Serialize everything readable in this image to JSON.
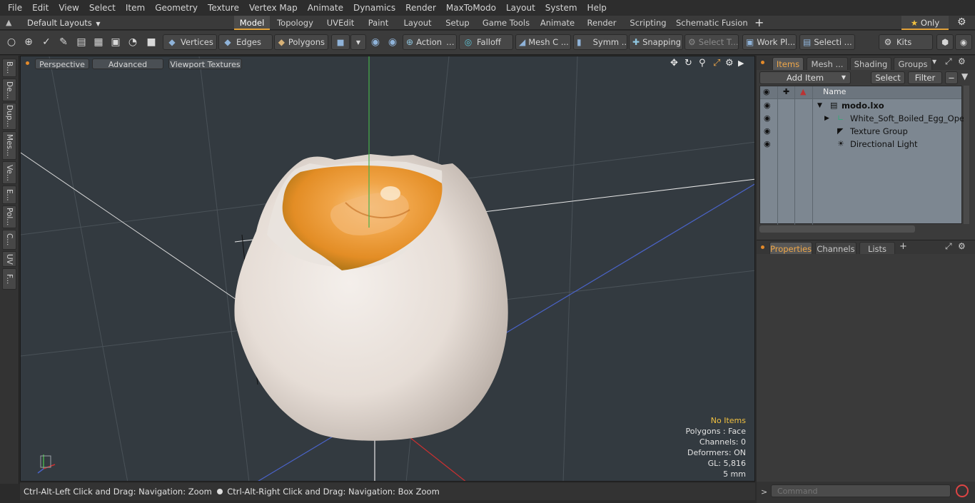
{
  "menu": [
    "File",
    "Edit",
    "View",
    "Select",
    "Item",
    "Geometry",
    "Texture",
    "Vertex Map",
    "Animate",
    "Dynamics",
    "Render",
    "MaxToModo",
    "Layout",
    "System",
    "Help"
  ],
  "layout_bar": {
    "layouts_label": "Default Layouts",
    "tabs": [
      "Model",
      "Topology",
      "UVEdit",
      "Paint",
      "Layout",
      "Setup",
      "Game Tools",
      "Animate",
      "Render",
      "Scripting",
      "Schematic Fusion"
    ],
    "active_tab": "Model",
    "only_label": "Only"
  },
  "toolbar": {
    "vertices": "Vertices",
    "edges": "Edges",
    "polygons": "Polygons",
    "action": "Action",
    "falloff": "Falloff",
    "mesh_c": "Mesh C ...",
    "symm": "Symm ...",
    "snapping": "Snapping",
    "select_t": "Select T...",
    "work_pl": "Work Pl...",
    "selecti": "Selecti ...",
    "kits": "Kits"
  },
  "left_tabs": [
    "B...",
    "De...",
    "Dup...",
    "Mes...",
    "Ve...",
    "E...",
    "Pol...",
    "C...",
    "UV",
    "F..."
  ],
  "viewport": {
    "tabs": [
      "Perspective",
      "Advanced",
      "Viewport Textures"
    ],
    "stats": {
      "no_items": "No Items",
      "polygons": "Polygons : Face",
      "channels": "Channels: 0",
      "deformers": "Deformers: ON",
      "gl": "GL: 5,816",
      "scale": "5 mm"
    }
  },
  "status_bar": {
    "left": "Ctrl-Alt-Left Click and Drag: Navigation: Zoom",
    "right": "Ctrl-Alt-Right Click and Drag: Navigation: Box Zoom"
  },
  "right_panel": {
    "tabs": [
      "Items",
      "Mesh ...",
      "Shading",
      "Groups"
    ],
    "active_tab": "Items",
    "add_item": "Add Item",
    "select": "Select",
    "filter": "Filter",
    "name_header": "Name",
    "items": [
      {
        "name": "modo.lxo",
        "bold": true
      },
      {
        "name": "White_Soft_Boiled_Egg_Open",
        "bold": false
      },
      {
        "name": "Texture Group",
        "bold": false
      },
      {
        "name": "Directional Light",
        "bold": false
      }
    ],
    "bottom_tabs": [
      "Properties",
      "Channels",
      "Lists"
    ],
    "bottom_active": "Properties",
    "command_placeholder": "Command"
  },
  "colors": {
    "accent": "#e3a23a",
    "viewport_bg": "#333a40",
    "list_bg": "#7d8791"
  }
}
